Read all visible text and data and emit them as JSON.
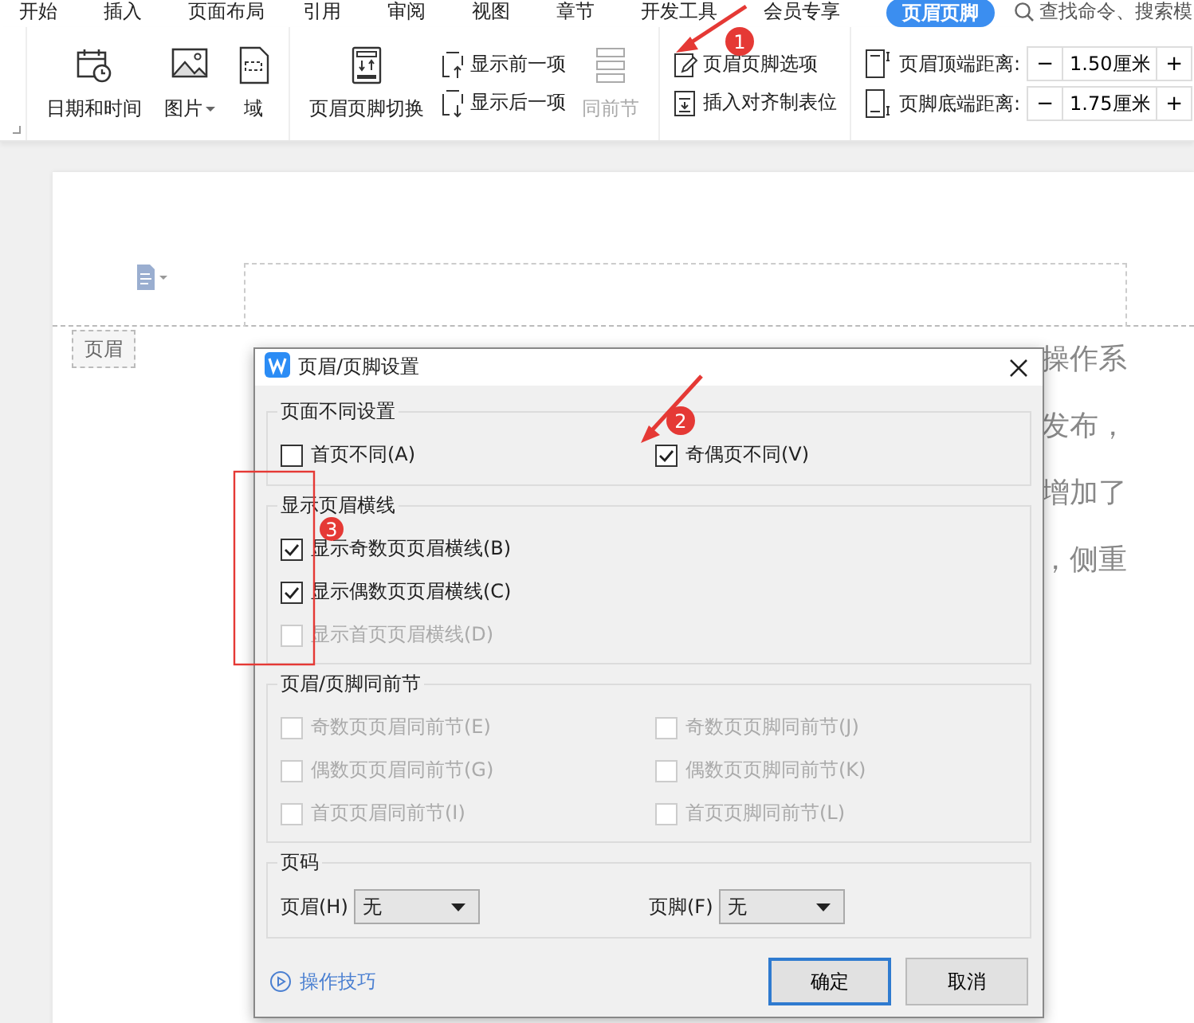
{
  "menu_tabs": [
    {
      "label": "开始",
      "selected": false
    },
    {
      "label": "插入",
      "selected": false
    },
    {
      "label": "页面布局",
      "selected": false
    },
    {
      "label": "引用",
      "selected": false
    },
    {
      "label": "审阅",
      "selected": false
    },
    {
      "label": "视图",
      "selected": false
    },
    {
      "label": "章节",
      "selected": false
    },
    {
      "label": "开发工具",
      "selected": false
    },
    {
      "label": "会员专享",
      "selected": false
    },
    {
      "label": "页眉页脚",
      "selected": true
    }
  ],
  "search": {
    "placeholder": "查找命令、搜索模"
  },
  "ribbon": {
    "date_time": {
      "label": "日期和时间"
    },
    "picture": {
      "label": "图片"
    },
    "field": {
      "label": "域"
    },
    "switch": {
      "label": "页眉页脚切换"
    },
    "show_prev": {
      "label": "显示前一项"
    },
    "show_next": {
      "label": "显示后一项"
    },
    "same_as_previous": {
      "label": "同前节",
      "disabled": true
    },
    "options": {
      "label": "页眉页脚选项"
    },
    "insert_tab": {
      "label": "插入对齐制表位"
    },
    "header_top": {
      "label": "页眉顶端距离:",
      "value": "1.50厘米",
      "minus": "−",
      "plus": "+"
    },
    "footer_bottom": {
      "label": "页脚底端距离:",
      "value": "1.75厘米",
      "minus": "−",
      "plus": "+"
    }
  },
  "document": {
    "header_tag": "页眉",
    "text_fragments": [
      "操作系",
      "发布，",
      "增加了",
      "，侧重"
    ]
  },
  "dialog": {
    "title": "页眉/页脚设置",
    "sections": [
      {
        "title": "页面不同设置",
        "disabled": false,
        "options": [
          {
            "label": "首页不同(A)",
            "checked": false,
            "disabled": false
          },
          {
            "label": "奇偶页不同(V)",
            "checked": true,
            "disabled": false
          }
        ]
      },
      {
        "title": "显示页眉横线",
        "disabled": false,
        "options": [
          {
            "label": "显示奇数页页眉横线(B)",
            "checked": true,
            "disabled": false
          },
          {
            "label": "显示偶数页页眉横线(C)",
            "checked": true,
            "disabled": false
          },
          {
            "label": "显示首页页眉横线(D)",
            "checked": false,
            "disabled": true
          }
        ]
      },
      {
        "title": "页眉/页脚同前节",
        "disabled": false,
        "options": [
          {
            "label": "奇数页页眉同前节(E)",
            "checked": false,
            "disabled": true
          },
          {
            "label": "奇数页页脚同前节(J)",
            "checked": false,
            "disabled": true
          },
          {
            "label": "偶数页页眉同前节(G)",
            "checked": false,
            "disabled": true
          },
          {
            "label": "偶数页页脚同前节(K)",
            "checked": false,
            "disabled": true
          },
          {
            "label": "首页页眉同前节(I)",
            "checked": false,
            "disabled": true
          },
          {
            "label": "首页页脚同前节(L)",
            "checked": false,
            "disabled": true
          }
        ]
      }
    ],
    "page_number": {
      "title": "页码",
      "header": {
        "label": "页眉(H)",
        "value": "无"
      },
      "footer": {
        "label": "页脚(F)",
        "value": "无"
      }
    },
    "tips_link": "操作技巧",
    "ok": "确定",
    "cancel": "取消"
  },
  "annotations": [
    {
      "number": "1"
    },
    {
      "number": "2"
    },
    {
      "number": "3"
    }
  ]
}
